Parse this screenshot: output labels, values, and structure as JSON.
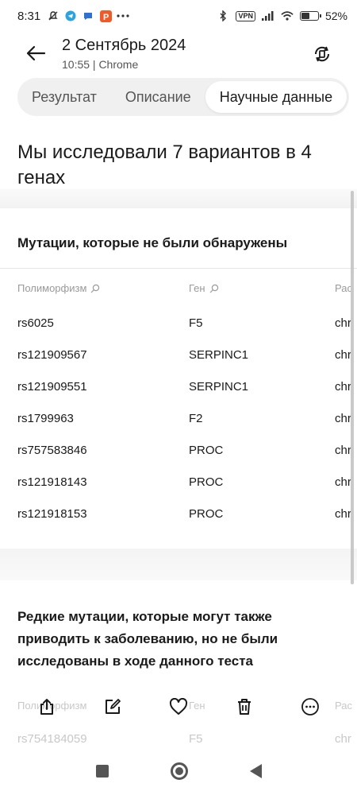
{
  "status_bar": {
    "time": "8:31",
    "battery": "52%",
    "battery_level": 0.52,
    "vpn": "VPN"
  },
  "header": {
    "title": "2 Сентябрь 2024",
    "subtitle": "10:55 | Chrome"
  },
  "tabs": [
    {
      "label": "Результат",
      "active": false
    },
    {
      "label": "Описание",
      "active": false
    },
    {
      "label": "Научные данные",
      "active": true
    }
  ],
  "main": {
    "heading": "Мы исследовали 7 вариантов в 4 генах"
  },
  "not_found_section": {
    "title": "Мутации, которые не были обнаружены",
    "columns": [
      "Полиморфизм",
      "Ген",
      "Рас"
    ],
    "rows": [
      {
        "polymorphism": "rs6025",
        "gene": "F5",
        "location": "chr"
      },
      {
        "polymorphism": "rs121909567",
        "gene": "SERPINC1",
        "location": "chr"
      },
      {
        "polymorphism": "rs121909551",
        "gene": "SERPINC1",
        "location": "chr"
      },
      {
        "polymorphism": "rs1799963",
        "gene": "F2",
        "location": "chr"
      },
      {
        "polymorphism": "rs757583846",
        "gene": "PROC",
        "location": "chr"
      },
      {
        "polymorphism": "rs121918143",
        "gene": "PROC",
        "location": "chr"
      },
      {
        "polymorphism": "rs121918153",
        "gene": "PROC",
        "location": "chr"
      }
    ]
  },
  "rare_section": {
    "title": "Редкие мутации, которые могут также приводить к заболеванию, но не были исследованы в ходе данного теста",
    "ghost_header": [
      "Полиморфизм",
      "Ген",
      "Рас"
    ],
    "ghost_row": {
      "polymorphism": "rs754184059",
      "gene": "F5",
      "location": "chr"
    }
  },
  "action_bar": {
    "icons": [
      "share-icon",
      "edit-icon",
      "heart-icon",
      "trash-icon",
      "more-icon"
    ]
  },
  "colors": {
    "tab_bg": "#f0f0f0",
    "header_text": "#9a9a9a",
    "accent": "#1a1a1a"
  }
}
